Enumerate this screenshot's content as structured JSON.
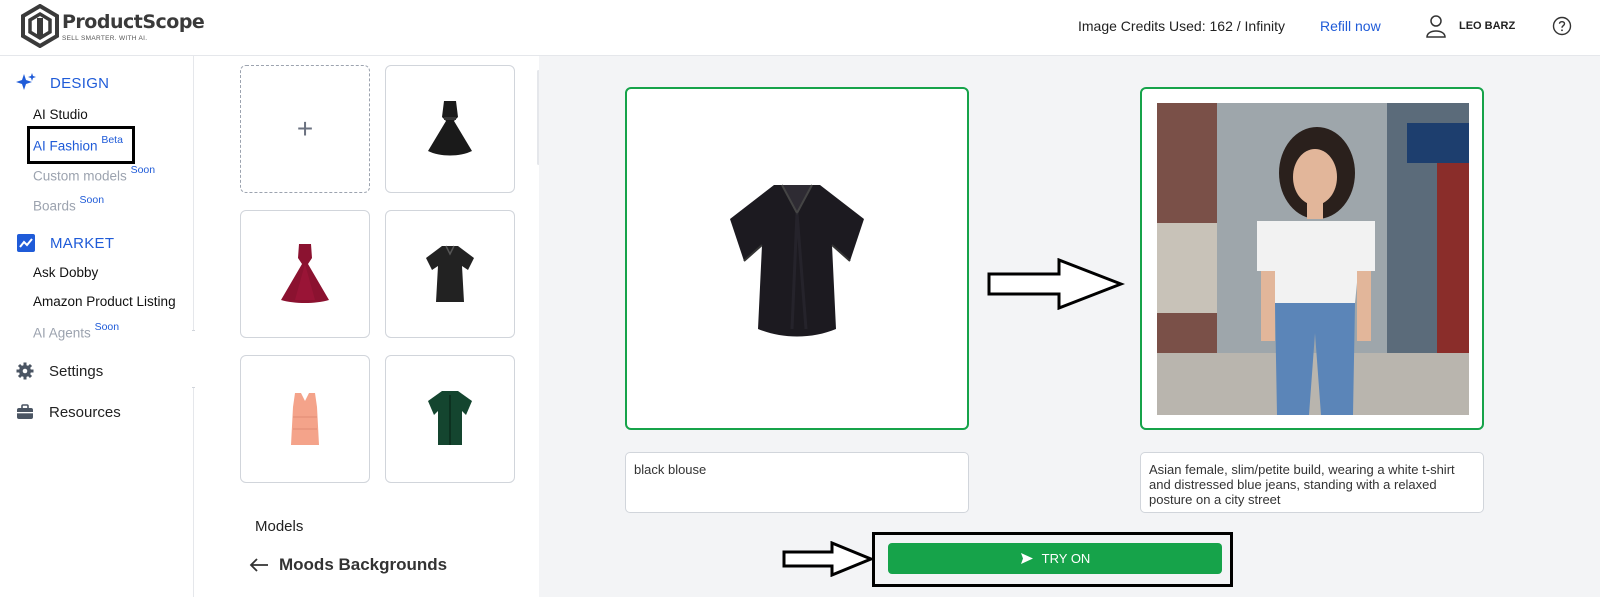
{
  "header": {
    "brand_name": "ProductScope",
    "brand_tagline": "SELL SMARTER. WITH AI.",
    "credits_text": "Image Credits Used: 162 / Infinity",
    "refill_label": "Refill now",
    "user_name": "LEO BARZ"
  },
  "sidebar": {
    "design": {
      "label": "DESIGN",
      "items": [
        {
          "label": "AI Studio",
          "badge": ""
        },
        {
          "label": "AI Fashion",
          "badge": "Beta"
        },
        {
          "label": "Custom models",
          "badge": "Soon"
        },
        {
          "label": "Boards",
          "badge": "Soon"
        }
      ]
    },
    "market": {
      "label": "MARKET",
      "items": [
        {
          "label": "Ask Dobby",
          "badge": ""
        },
        {
          "label": "Amazon Product Listing",
          "badge": ""
        },
        {
          "label": "AI Agents",
          "badge": "Soon"
        }
      ]
    },
    "settings_label": "Settings",
    "resources_label": "Resources",
    "collapse_glyph": "⇄"
  },
  "gallery": {
    "add_label": "+",
    "items": [
      "black-dress",
      "red-gown",
      "black-blouse",
      "peach-tank-top",
      "green-shirt"
    ],
    "models_label": "Models",
    "moods_label": "Moods Backgrounds"
  },
  "main": {
    "garment_description": "black blouse",
    "model_description": "Asian female, slim/petite build, wearing a white t-shirt and distressed blue jeans, standing with a relaxed posture on a city street",
    "try_on_label": "TRY ON"
  },
  "colors": {
    "accent_blue": "#1f5bd8",
    "success_green": "#16a34a",
    "muted_gray": "#9ca3af"
  }
}
